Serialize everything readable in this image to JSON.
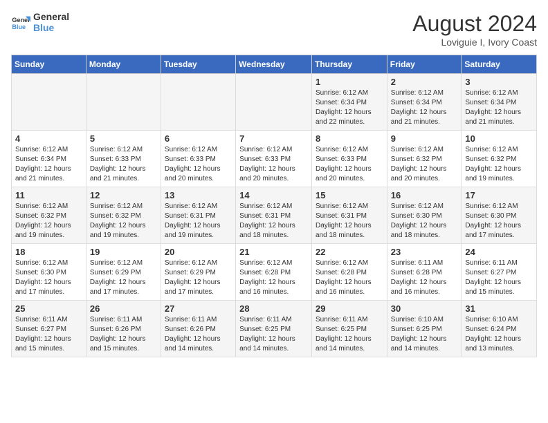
{
  "logo": {
    "line1": "General",
    "line2": "Blue"
  },
  "title": "August 2024",
  "location": "Loviguie I, Ivory Coast",
  "days_header": [
    "Sunday",
    "Monday",
    "Tuesday",
    "Wednesday",
    "Thursday",
    "Friday",
    "Saturday"
  ],
  "weeks": [
    [
      {
        "day": "",
        "detail": ""
      },
      {
        "day": "",
        "detail": ""
      },
      {
        "day": "",
        "detail": ""
      },
      {
        "day": "",
        "detail": ""
      },
      {
        "day": "1",
        "detail": "Sunrise: 6:12 AM\nSunset: 6:34 PM\nDaylight: 12 hours and 22 minutes."
      },
      {
        "day": "2",
        "detail": "Sunrise: 6:12 AM\nSunset: 6:34 PM\nDaylight: 12 hours and 21 minutes."
      },
      {
        "day": "3",
        "detail": "Sunrise: 6:12 AM\nSunset: 6:34 PM\nDaylight: 12 hours and 21 minutes."
      }
    ],
    [
      {
        "day": "4",
        "detail": "Sunrise: 6:12 AM\nSunset: 6:34 PM\nDaylight: 12 hours and 21 minutes."
      },
      {
        "day": "5",
        "detail": "Sunrise: 6:12 AM\nSunset: 6:33 PM\nDaylight: 12 hours and 21 minutes."
      },
      {
        "day": "6",
        "detail": "Sunrise: 6:12 AM\nSunset: 6:33 PM\nDaylight: 12 hours and 20 minutes."
      },
      {
        "day": "7",
        "detail": "Sunrise: 6:12 AM\nSunset: 6:33 PM\nDaylight: 12 hours and 20 minutes."
      },
      {
        "day": "8",
        "detail": "Sunrise: 6:12 AM\nSunset: 6:33 PM\nDaylight: 12 hours and 20 minutes."
      },
      {
        "day": "9",
        "detail": "Sunrise: 6:12 AM\nSunset: 6:32 PM\nDaylight: 12 hours and 20 minutes."
      },
      {
        "day": "10",
        "detail": "Sunrise: 6:12 AM\nSunset: 6:32 PM\nDaylight: 12 hours and 19 minutes."
      }
    ],
    [
      {
        "day": "11",
        "detail": "Sunrise: 6:12 AM\nSunset: 6:32 PM\nDaylight: 12 hours and 19 minutes."
      },
      {
        "day": "12",
        "detail": "Sunrise: 6:12 AM\nSunset: 6:32 PM\nDaylight: 12 hours and 19 minutes."
      },
      {
        "day": "13",
        "detail": "Sunrise: 6:12 AM\nSunset: 6:31 PM\nDaylight: 12 hours and 19 minutes."
      },
      {
        "day": "14",
        "detail": "Sunrise: 6:12 AM\nSunset: 6:31 PM\nDaylight: 12 hours and 18 minutes."
      },
      {
        "day": "15",
        "detail": "Sunrise: 6:12 AM\nSunset: 6:31 PM\nDaylight: 12 hours and 18 minutes."
      },
      {
        "day": "16",
        "detail": "Sunrise: 6:12 AM\nSunset: 6:30 PM\nDaylight: 12 hours and 18 minutes."
      },
      {
        "day": "17",
        "detail": "Sunrise: 6:12 AM\nSunset: 6:30 PM\nDaylight: 12 hours and 17 minutes."
      }
    ],
    [
      {
        "day": "18",
        "detail": "Sunrise: 6:12 AM\nSunset: 6:30 PM\nDaylight: 12 hours and 17 minutes."
      },
      {
        "day": "19",
        "detail": "Sunrise: 6:12 AM\nSunset: 6:29 PM\nDaylight: 12 hours and 17 minutes."
      },
      {
        "day": "20",
        "detail": "Sunrise: 6:12 AM\nSunset: 6:29 PM\nDaylight: 12 hours and 17 minutes."
      },
      {
        "day": "21",
        "detail": "Sunrise: 6:12 AM\nSunset: 6:28 PM\nDaylight: 12 hours and 16 minutes."
      },
      {
        "day": "22",
        "detail": "Sunrise: 6:12 AM\nSunset: 6:28 PM\nDaylight: 12 hours and 16 minutes."
      },
      {
        "day": "23",
        "detail": "Sunrise: 6:11 AM\nSunset: 6:28 PM\nDaylight: 12 hours and 16 minutes."
      },
      {
        "day": "24",
        "detail": "Sunrise: 6:11 AM\nSunset: 6:27 PM\nDaylight: 12 hours and 15 minutes."
      }
    ],
    [
      {
        "day": "25",
        "detail": "Sunrise: 6:11 AM\nSunset: 6:27 PM\nDaylight: 12 hours and 15 minutes."
      },
      {
        "day": "26",
        "detail": "Sunrise: 6:11 AM\nSunset: 6:26 PM\nDaylight: 12 hours and 15 minutes."
      },
      {
        "day": "27",
        "detail": "Sunrise: 6:11 AM\nSunset: 6:26 PM\nDaylight: 12 hours and 14 minutes."
      },
      {
        "day": "28",
        "detail": "Sunrise: 6:11 AM\nSunset: 6:25 PM\nDaylight: 12 hours and 14 minutes."
      },
      {
        "day": "29",
        "detail": "Sunrise: 6:11 AM\nSunset: 6:25 PM\nDaylight: 12 hours and 14 minutes."
      },
      {
        "day": "30",
        "detail": "Sunrise: 6:10 AM\nSunset: 6:25 PM\nDaylight: 12 hours and 14 minutes."
      },
      {
        "day": "31",
        "detail": "Sunrise: 6:10 AM\nSunset: 6:24 PM\nDaylight: 12 hours and 13 minutes."
      }
    ]
  ]
}
